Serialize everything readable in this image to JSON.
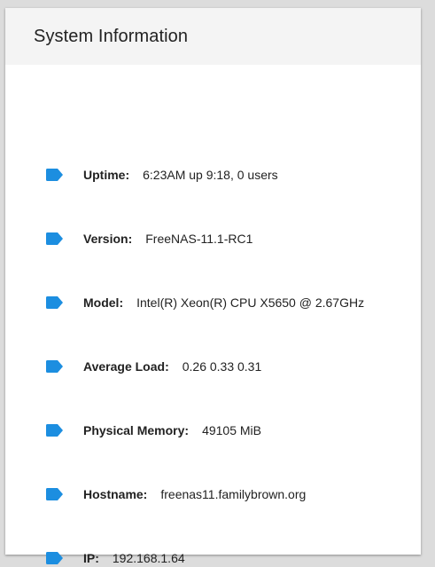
{
  "card": {
    "title": "System Information"
  },
  "colors": {
    "tag_icon": "#1c8ee0"
  },
  "rows": [
    {
      "label": "Uptime:",
      "value": "6:23AM up 9:18, 0 users",
      "icon": "tag-icon"
    },
    {
      "label": "Version:",
      "value": "FreeNAS-11.1-RC1",
      "icon": "tag-icon"
    },
    {
      "label": "Model:",
      "value": "Intel(R) Xeon(R) CPU X5650 @ 2.67GHz",
      "icon": "tag-icon"
    },
    {
      "label": "Average Load:",
      "value": "0.26 0.33 0.31",
      "icon": "tag-icon"
    },
    {
      "label": "Physical Memory:",
      "value": "49105 MiB",
      "icon": "tag-icon"
    },
    {
      "label": "Hostname:",
      "value": "freenas11.familybrown.org",
      "icon": "tag-icon"
    },
    {
      "label": "IP:",
      "value": "192.168.1.64",
      "icon": "tag-icon"
    }
  ]
}
